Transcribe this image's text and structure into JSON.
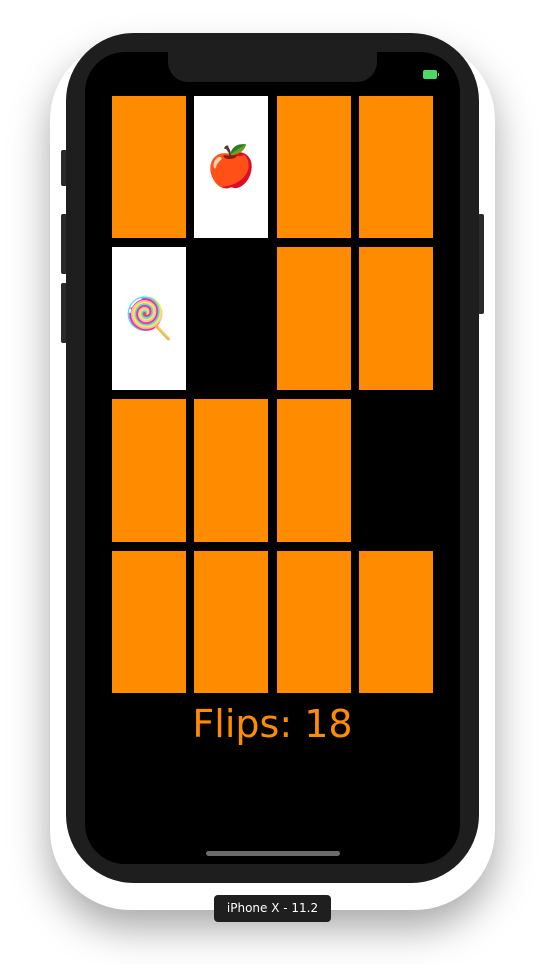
{
  "device": {
    "label": "iPhone X - 11.2"
  },
  "status_bar": {
    "battery_icon": "battery-charging-icon",
    "battery_color": "#4cd964"
  },
  "colors": {
    "card_back": "#ff8c00",
    "card_face": "#ffffff",
    "background": "#000000",
    "flips_text": "#ff8c00"
  },
  "game": {
    "flips_label": "Flips: 18",
    "cards": [
      {
        "state": "face-down",
        "emoji": ""
      },
      {
        "state": "face-up",
        "emoji": "🍎"
      },
      {
        "state": "face-down",
        "emoji": ""
      },
      {
        "state": "face-down",
        "emoji": ""
      },
      {
        "state": "face-up",
        "emoji": "🍭"
      },
      {
        "state": "matched",
        "emoji": ""
      },
      {
        "state": "face-down",
        "emoji": ""
      },
      {
        "state": "face-down",
        "emoji": ""
      },
      {
        "state": "face-down",
        "emoji": ""
      },
      {
        "state": "face-down",
        "emoji": ""
      },
      {
        "state": "face-down",
        "emoji": ""
      },
      {
        "state": "matched",
        "emoji": ""
      },
      {
        "state": "face-down",
        "emoji": ""
      },
      {
        "state": "face-down",
        "emoji": ""
      },
      {
        "state": "face-down",
        "emoji": ""
      },
      {
        "state": "face-down",
        "emoji": ""
      }
    ]
  }
}
